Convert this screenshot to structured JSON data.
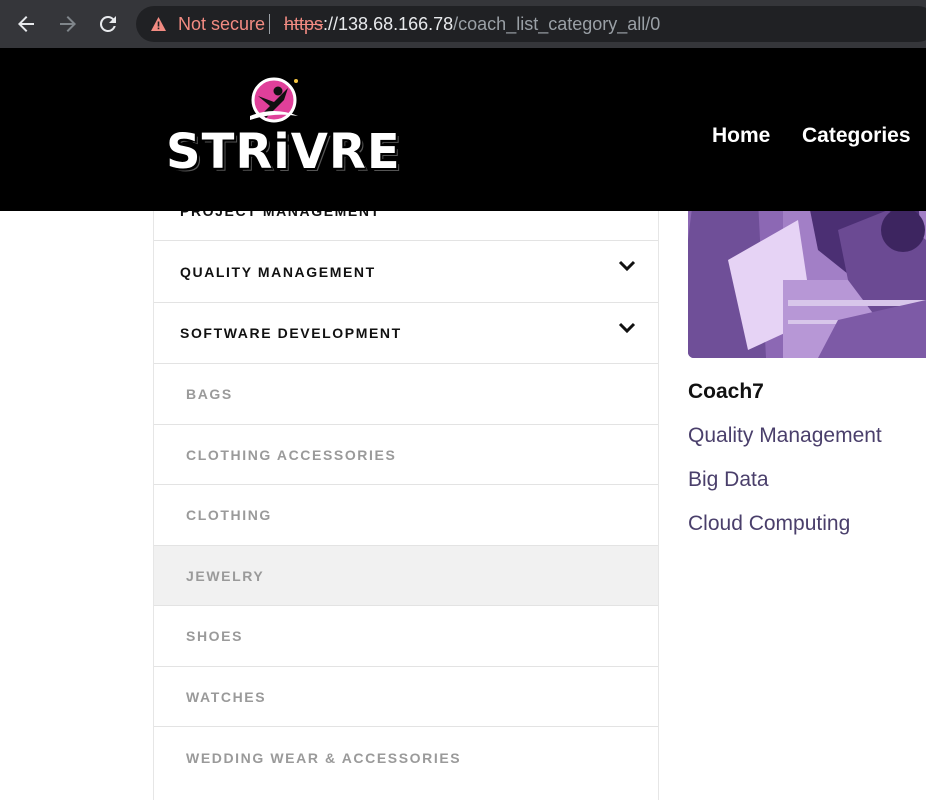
{
  "browser": {
    "security_label": "Not secure",
    "url_scheme": "https",
    "url_host": "://138.68.166.78",
    "url_path": "/coach_list_category_all/0",
    "icons": [
      "back-arrow-icon",
      "forward-arrow-icon",
      "reload-icon",
      "warning-icon"
    ]
  },
  "header": {
    "logo_text": "STRiVRE",
    "nav": {
      "home": "Home",
      "categories": "Categories"
    },
    "colors": {
      "background": "#000000",
      "logo_accent": "#e0409a"
    }
  },
  "categories": {
    "partial_top": "PROJECT MANAGEMENT",
    "parents": [
      {
        "label": "QUALITY MANAGEMENT",
        "expanded": false
      },
      {
        "label": "SOFTWARE DEVELOPMENT",
        "expanded": false
      }
    ],
    "children": [
      {
        "label": "BAGS",
        "active": false
      },
      {
        "label": "CLOTHING ACCESSORIES",
        "active": false
      },
      {
        "label": "CLOTHING",
        "active": false
      },
      {
        "label": "JEWELRY",
        "active": true
      },
      {
        "label": "SHOES",
        "active": false
      },
      {
        "label": "WATCHES",
        "active": false
      },
      {
        "label": "WEDDING WEAR & ACCESSORIES",
        "active": false
      }
    ]
  },
  "coach": {
    "name": "Coach7",
    "categories": [
      "Quality Management",
      "Big Data",
      "Cloud Computing"
    ],
    "image_tint": "#8e6bb2"
  }
}
